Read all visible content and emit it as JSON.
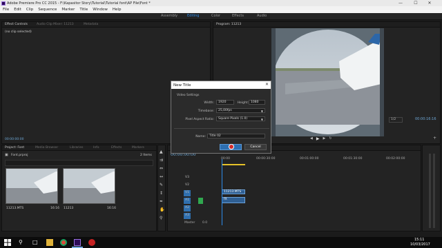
{
  "window": {
    "title": "Adobe Premiere Pro CC 2015 - F:\\Kapasitor Story\\Tutorial\\Tutorial font\\AP File\\Font *",
    "minimize": "—",
    "maximize": "☐",
    "close": "✕"
  },
  "menu": [
    "File",
    "Edit",
    "Clip",
    "Sequence",
    "Marker",
    "Title",
    "Window",
    "Help"
  ],
  "workspaces": [
    {
      "label": "Assembly"
    },
    {
      "label": "Editing"
    },
    {
      "label": "Color"
    },
    {
      "label": "Effects"
    },
    {
      "label": "Audio"
    }
  ],
  "source_panel": {
    "tabs": [
      "Effect Controls",
      "Audio Clip Mixer: 11213",
      "Metadata"
    ],
    "no_clip": "(no clip selected)",
    "timecode": "00:00:00:00"
  },
  "program_panel": {
    "tab": "Program: 11213",
    "fit": "1/2",
    "timecode_right": "00:00:16:16"
  },
  "project_panel": {
    "tabs": [
      "Project: Font",
      "Media Browser",
      "Libraries",
      "Info",
      "Effects",
      "Markers"
    ],
    "project_file": "Font.prproj",
    "item_count": "2 Items",
    "items": [
      {
        "name": "11213.MTS",
        "duration": "16:16"
      },
      {
        "name": "11213",
        "duration": "16:16"
      }
    ]
  },
  "timeline": {
    "timecode": "00:00:00:00",
    "ruler": [
      "00:00",
      "00:00:30:00",
      "00:01:00:00",
      "00:01:30:00",
      "00:02:00:00"
    ],
    "video_tracks": [
      "V3",
      "V2",
      "V1"
    ],
    "audio_tracks": [
      "A1",
      "A2",
      "A3"
    ],
    "master": {
      "label": "Master",
      "value": "0.0"
    },
    "video_clip": "11213.MTS",
    "audio_clip": "fX"
  },
  "dialog": {
    "title": "New Title",
    "section": "Video Settings",
    "width_label": "Width:",
    "width_value": "1920",
    "height_label": "Height:",
    "height_value": "1080",
    "timebase_label": "Timebase:",
    "timebase_value": "25,00fps",
    "par_label": "Pixel Aspect Ratio:",
    "par_value": "Square Pixels (1.0)",
    "name_label": "Name:",
    "name_value": "Title 02",
    "ok": "OK",
    "cancel": "Cancel"
  },
  "taskbar": {
    "time": "15:11",
    "date": "10/03/2017"
  },
  "colors": {
    "accent": "#2d8ceb",
    "ok_button": "#2d6fb2",
    "premiere_purple": "#2d0b57",
    "audio_track_green": "#30a84f"
  }
}
